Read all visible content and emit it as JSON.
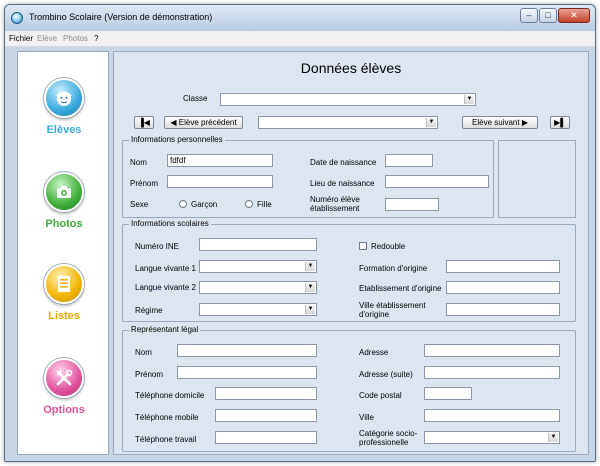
{
  "window": {
    "title": "Trombino Scolaire (Version de démonstration)",
    "close_glyph": "✕",
    "min_glyph": "–",
    "max_glyph": "□"
  },
  "menu": {
    "items": [
      "Fichier",
      "Elève",
      "Photos",
      "?"
    ]
  },
  "sidebar": {
    "items": [
      {
        "label": "Elèves",
        "icon": "student-face-icon",
        "color": "#39a9dd"
      },
      {
        "label": "Photos",
        "icon": "camera-icon",
        "color": "#3fae3a"
      },
      {
        "label": "Listes",
        "icon": "list-icon",
        "color": "#f0b400"
      },
      {
        "label": "Options",
        "icon": "tools-icon",
        "color": "#e0529c"
      }
    ]
  },
  "main": {
    "title": "Données élèves",
    "classe_label": "Classe",
    "classe_value": "",
    "nav": {
      "prev_label": "Elève précédent",
      "next_label": "Elève suivant",
      "student_value": ""
    },
    "personal": {
      "title": "Informations personnelles",
      "nom_label": "Nom",
      "nom_value": "fdfdf",
      "prenom_label": "Prénom",
      "prenom_value": "",
      "sexe_label": "Sexe",
      "garcon_label": "Garçon",
      "fille_label": "Fille",
      "dob_label": "Date de naissance",
      "dob_value": "",
      "lieu_label": "Lieu de naissance",
      "lieu_value": "",
      "numero_label": "Numéro élève établissement",
      "numero_value": ""
    },
    "school": {
      "title": "Informations scolaires",
      "ine_label": "Numéro INE",
      "ine_value": "",
      "lv1_label": "Langue vivante 1",
      "lv1_value": "",
      "lv2_label": "Langue vivante 2",
      "lv2_value": "",
      "regime_label": "Régime",
      "regime_value": "",
      "redouble_label": "Redouble",
      "formation_label": "Formation d'origine",
      "formation_value": "",
      "etab_label": "Etablissement d'origine",
      "etab_value": "",
      "ville_etab_label": "Ville établissement d'origine",
      "ville_etab_value": ""
    },
    "legal": {
      "title": "Représentant légal",
      "nom_label": "Nom",
      "nom_value": "",
      "prenom_label": "Prénom",
      "prenom_value": "",
      "tel_dom_label": "Téléphone domicile",
      "tel_dom_value": "",
      "tel_mob_label": "Téléphone mobile",
      "tel_mob_value": "",
      "tel_trav_label": "Téléphone travail",
      "tel_trav_value": "",
      "adresse_label": "Adresse",
      "adresse_value": "",
      "adresse2_label": "Adresse (suite)",
      "adresse2_value": "",
      "cp_label": "Code postal",
      "cp_value": "",
      "ville_label": "Ville",
      "ville_value": "",
      "csp_label": "Catégorie socio-professionelle",
      "csp_value": ""
    }
  }
}
